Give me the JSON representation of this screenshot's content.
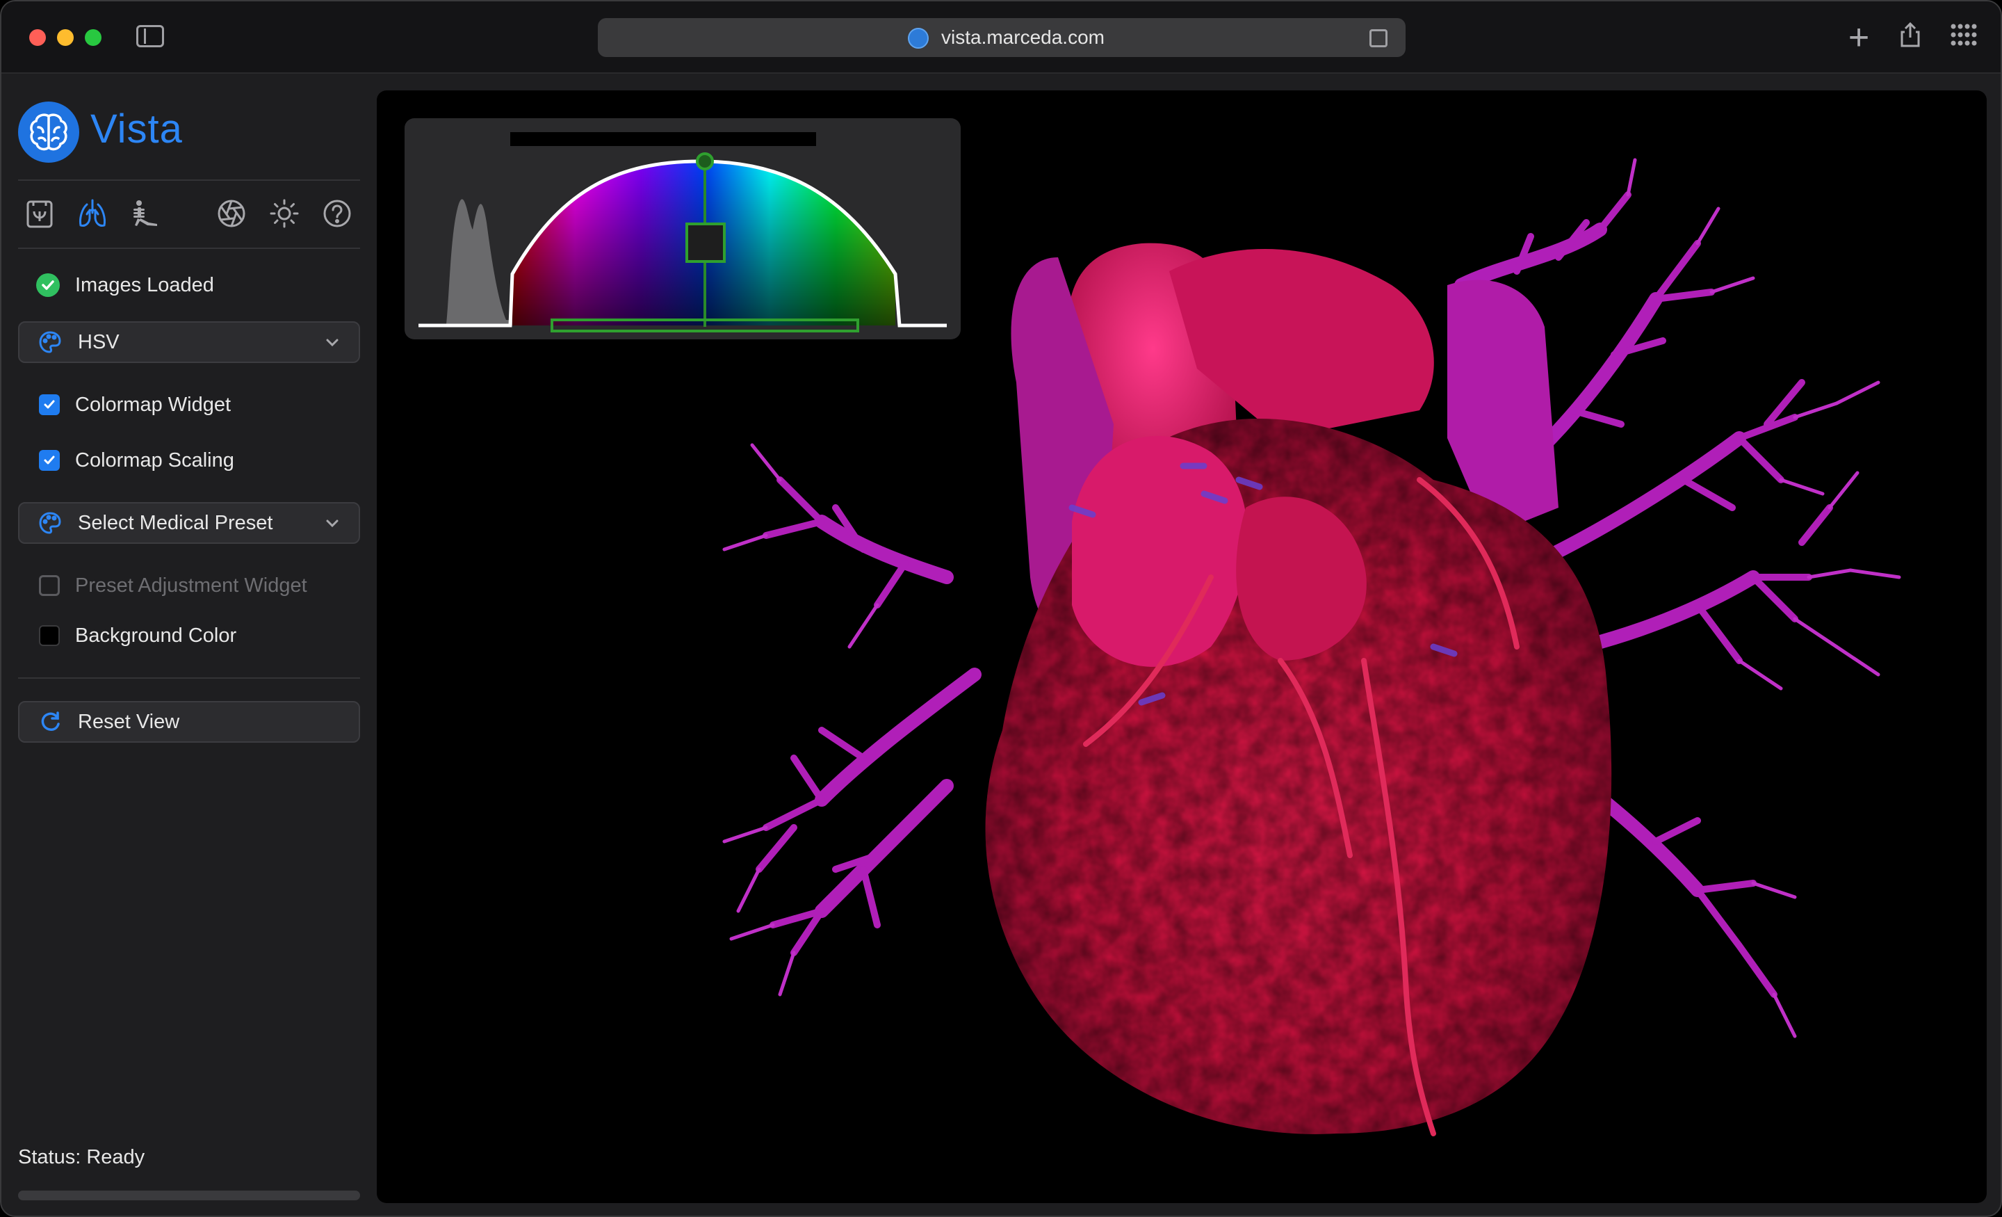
{
  "browser": {
    "url": "vista.marceda.com"
  },
  "app": {
    "title": "Vista"
  },
  "sidebar": {
    "mode_icons": [
      "volume-icon",
      "lungs-icon",
      "skeleton-icon",
      "aperture-icon",
      "brightness-icon",
      "help-icon"
    ],
    "status_item": {
      "label": "Images Loaded",
      "state": "ok"
    },
    "colormap_select": {
      "value": "HSV"
    },
    "options": [
      {
        "label": "Colormap Widget",
        "checked": true
      },
      {
        "label": "Colormap Scaling",
        "checked": true
      }
    ],
    "preset_select": {
      "value": "Select Medical Preset"
    },
    "preset_adjustment": {
      "label": "Preset Adjustment Widget",
      "checked": false,
      "disabled": true
    },
    "background_color": {
      "label": "Background Color",
      "color": "#000000"
    },
    "reset_button": {
      "label": "Reset View"
    },
    "status": "Status: Ready"
  },
  "colors": {
    "accent": "#2d86f5",
    "ok": "#30c060",
    "tissue": "#d01040",
    "vessels": "#b020c0"
  }
}
